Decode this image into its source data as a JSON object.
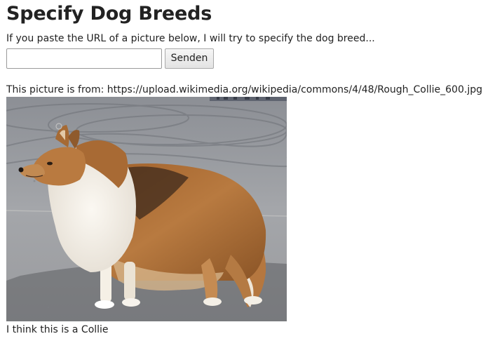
{
  "page": {
    "title": "Specify Dog Breeds",
    "intro": "If you paste the URL of a picture below, I will try to specify the dog breed..."
  },
  "form": {
    "url_value": "",
    "url_placeholder": "",
    "submit_label": "Senden"
  },
  "result": {
    "source_text": "This picture is from: https://upload.wikimedia.org/wikipedia/commons/4/48/Rough_Collie_600.jpg",
    "prediction_text": "I think this is a Collie"
  }
}
